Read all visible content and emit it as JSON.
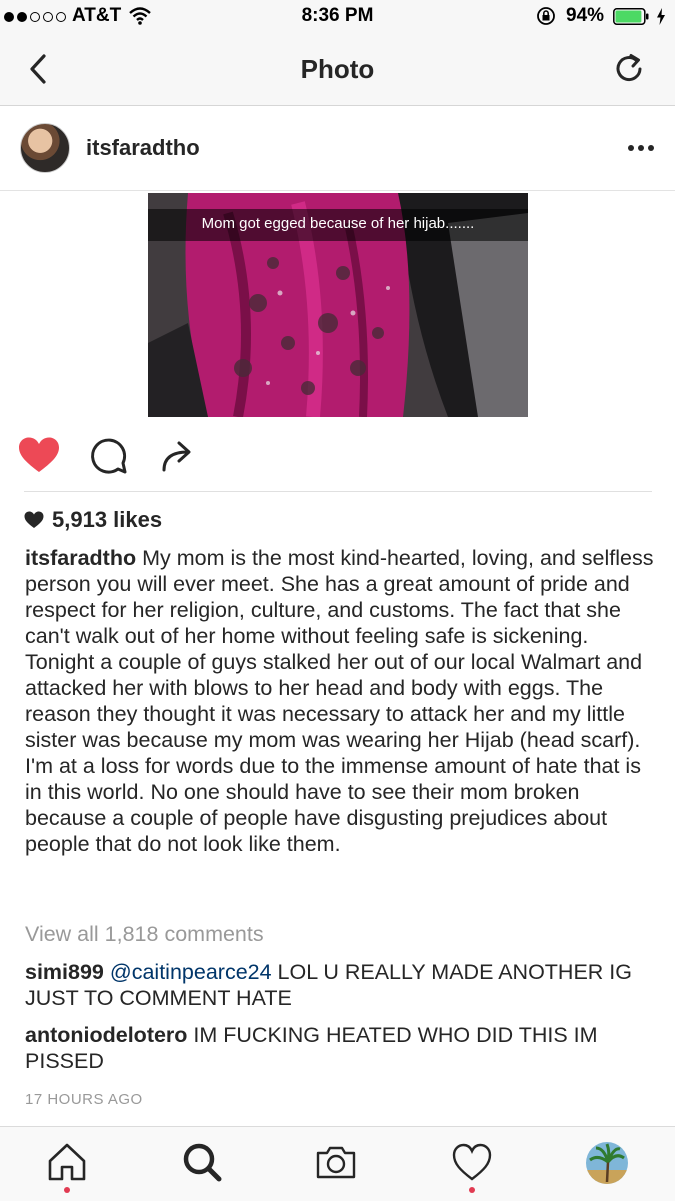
{
  "status_bar": {
    "carrier": "AT&T",
    "time": "8:36 PM",
    "battery": "94%",
    "battery_level": 0.94,
    "signal_bars_filled": 2,
    "signal_bars_total": 5
  },
  "nav": {
    "title": "Photo"
  },
  "post": {
    "username": "itsfaradtho",
    "photo_caption": "Mom got egged because of her hijab.......",
    "likes": "5,913 likes",
    "liked": true,
    "caption_user": "itsfaradtho",
    "caption_text": " My mom is the most kind-hearted, loving, and selfless person you will ever meet. She has a great amount of pride and respect for her religion, culture, and customs. The fact that she can't walk out of her home without feeling safe is sickening. Tonight a couple of guys stalked her out of our local Walmart and attacked her with blows to her head and body with eggs. The reason they thought it was necessary to attack her and my little sister was because my mom was wearing her Hijab (head scarf). I'm at a loss for words due to the immense amount of hate that is in this world. No one should have to see their mom broken because a couple of people have disgusting prejudices about people that do not look like them.",
    "view_all_comments": "View all 1,818 comments",
    "comments": [
      {
        "user": "simi899",
        "mention": "@caitinpearce24",
        "text": " LOL U REALLY MADE ANOTHER IG JUST TO COMMENT HATE"
      },
      {
        "user": "antoniodelotero",
        "text": " IM FUCKING HEATED WHO DID THIS IM PISSED"
      }
    ],
    "timestamp": "17 HOURS AGO"
  },
  "tab_bar": {
    "tabs": [
      "home",
      "search",
      "camera",
      "activity",
      "profile"
    ],
    "active": "search"
  },
  "colors": {
    "like_red": "#ed4956",
    "link_blue": "#003569",
    "battery_green": "#4cd964",
    "muted_gray": "#999999",
    "notification_dot": "#e13b52"
  },
  "icons": [
    "back-icon",
    "refresh-icon",
    "more-icon",
    "heart-icon",
    "comment-icon",
    "share-icon",
    "home-icon",
    "search-icon",
    "camera-icon",
    "activity-heart-icon",
    "lock-rotation-icon",
    "wifi-icon",
    "battery-icon",
    "charging-icon"
  ]
}
